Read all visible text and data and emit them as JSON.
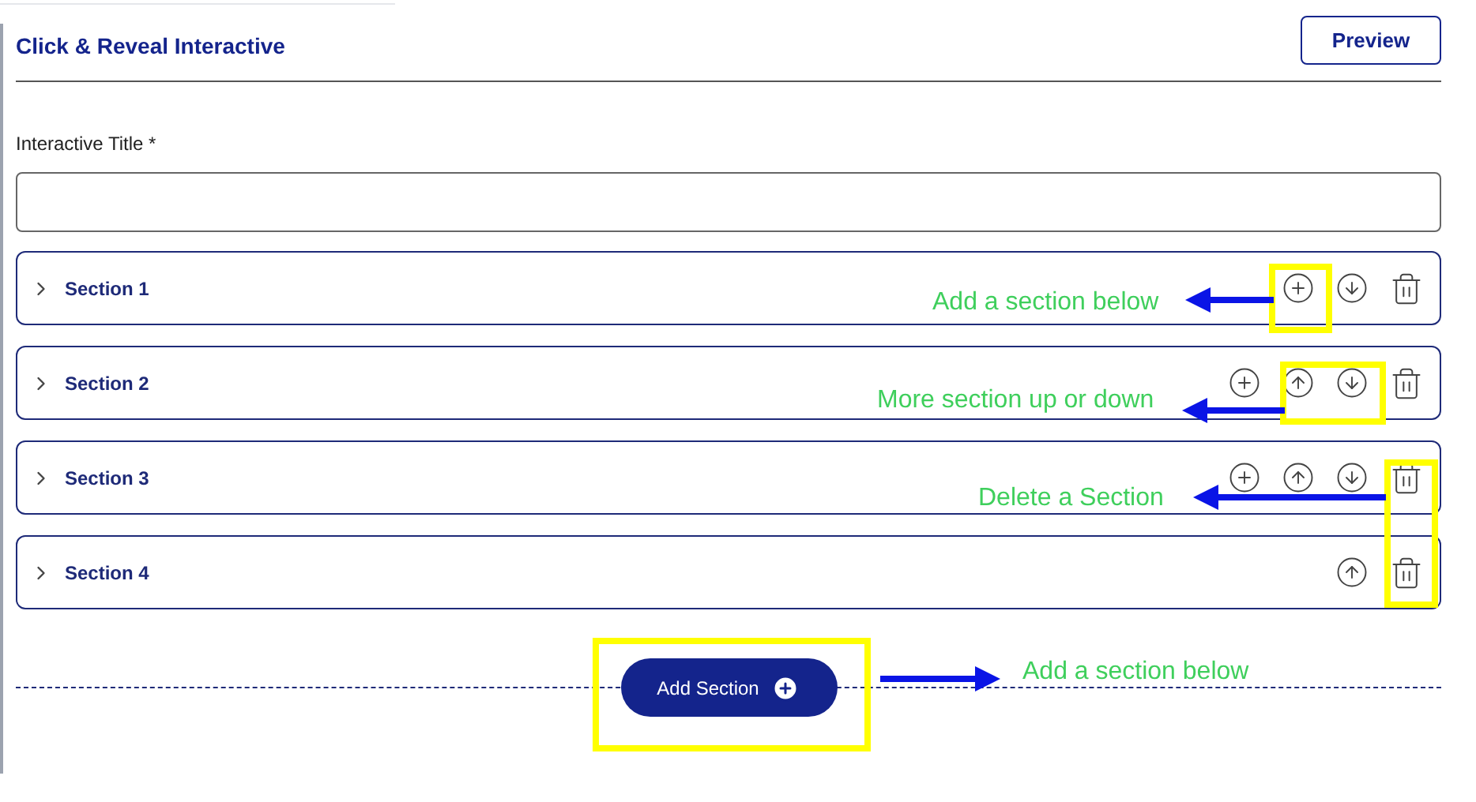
{
  "header": {
    "title": "Click & Reveal Interactive",
    "preview_button": "Preview"
  },
  "title_field": {
    "label": "Interactive Title *"
  },
  "sections": [
    {
      "label": "Section 1",
      "expanded": false,
      "actions": [
        {
          "kind": "add"
        },
        {
          "kind": "down"
        },
        {
          "kind": "delete"
        }
      ]
    },
    {
      "label": "Section 2",
      "expanded": false,
      "actions": [
        {
          "kind": "add"
        },
        {
          "kind": "up"
        },
        {
          "kind": "down"
        },
        {
          "kind": "delete"
        }
      ]
    },
    {
      "label": "Section 3",
      "expanded": false,
      "actions": [
        {
          "kind": "add"
        },
        {
          "kind": "up"
        },
        {
          "kind": "down"
        },
        {
          "kind": "delete"
        }
      ]
    },
    {
      "label": "Section 4",
      "expanded": false,
      "actions": [
        {
          "kind": "up"
        },
        {
          "kind": "delete"
        }
      ]
    }
  ],
  "add_section_button": "Add Section",
  "annotations": [
    {
      "text": "Add a section below"
    },
    {
      "text": "More section up or down"
    },
    {
      "text": "Delete a Section"
    },
    {
      "text": "Add a section below"
    }
  ]
}
